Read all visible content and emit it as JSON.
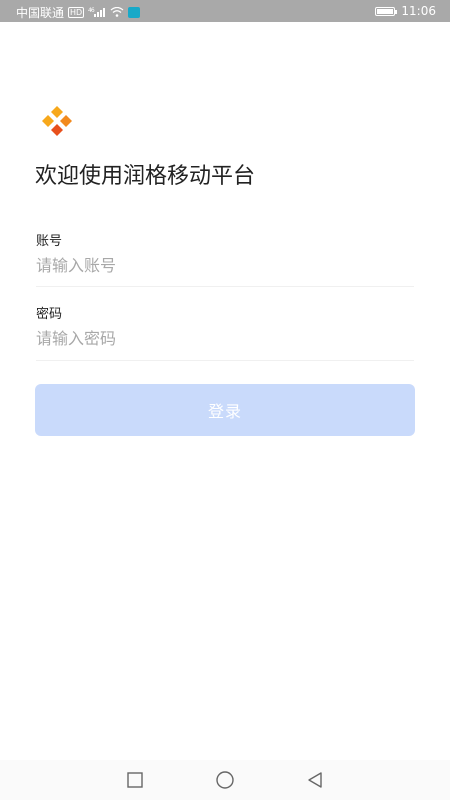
{
  "status_bar": {
    "carrier": "中国联通",
    "network_badge": "HD",
    "signal_label": "⁴⁶",
    "time": "11:06",
    "battery_level": 0.85,
    "icons": [
      "signal-icon",
      "wifi-icon",
      "app-notification-icon",
      "battery-icon"
    ]
  },
  "logo": {
    "icon": "logo-icon",
    "colors": [
      "#f7a81b",
      "#e8501c"
    ]
  },
  "welcome_title": "欢迎使用润格移动平台",
  "form": {
    "account_label": "账号",
    "account_placeholder": "请输入账号",
    "account_value": "",
    "password_label": "密码",
    "password_placeholder": "请输入密码",
    "password_value": ""
  },
  "login_button": {
    "label": "登录",
    "color": "#c9dafb"
  },
  "nav_bar": {
    "icons": [
      "recents-icon",
      "home-icon",
      "back-icon"
    ]
  }
}
